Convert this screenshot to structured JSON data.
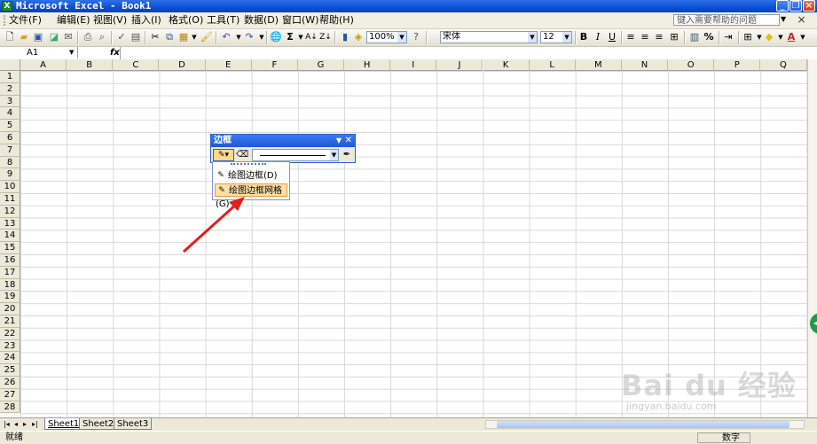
{
  "window": {
    "title": "Microsoft Excel - Book1",
    "app_icon": "X"
  },
  "menu": {
    "items": [
      "文件(F)",
      "编辑(E)",
      "视图(V)",
      "插入(I)",
      "格式(O)",
      "工具(T)",
      "数据(D)",
      "窗口(W)",
      "帮助(H)"
    ],
    "help_placeholder": "键入需要帮助的问题"
  },
  "toolbar": {
    "zoom": "100%",
    "font": "宋体",
    "font_size": "12",
    "bold": "B",
    "italic": "I",
    "underline": "U",
    "percent": "%"
  },
  "formula_bar": {
    "name_box": "A1",
    "fx": "fx"
  },
  "grid": {
    "columns": [
      "A",
      "B",
      "C",
      "D",
      "E",
      "F",
      "G",
      "H",
      "I",
      "J",
      "K",
      "L",
      "M",
      "N",
      "O",
      "P",
      "Q"
    ],
    "rows": [
      "1",
      "2",
      "3",
      "4",
      "5",
      "6",
      "7",
      "8",
      "9",
      "10",
      "11",
      "12",
      "13",
      "14",
      "15",
      "16",
      "17",
      "18",
      "19",
      "20",
      "21",
      "22",
      "23",
      "24",
      "25",
      "26",
      "27",
      "28"
    ]
  },
  "sheets": [
    "Sheet1",
    "Sheet2",
    "Sheet3"
  ],
  "status": {
    "left": "就绪",
    "right": "数字"
  },
  "borders_toolbar": {
    "title": "边框",
    "menu": [
      {
        "label": "绘图边框(D)",
        "highlighted": false
      },
      {
        "label": "绘图边框网格(G)",
        "highlighted": true
      }
    ]
  },
  "watermark": {
    "main": "Bai du 经验",
    "sub": "jingyan.baidu.com"
  },
  "colors": {
    "title_bar": "#0a4fd6",
    "annotation_arrow": "#e02020",
    "highlight": "#ffe0a8"
  }
}
